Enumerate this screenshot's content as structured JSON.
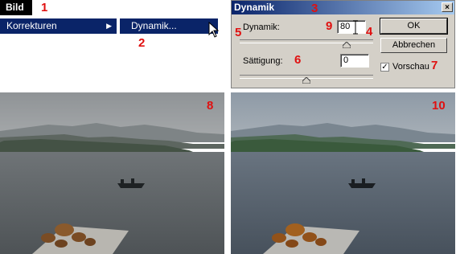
{
  "menu": {
    "bild_label": "Bild",
    "korrekturen_label": "Korrekturen",
    "dynamik_item_label": "Dynamik..."
  },
  "markers": {
    "m1": "1",
    "m2": "2",
    "m3": "3",
    "m4": "4",
    "m5": "5",
    "m6": "6",
    "m7": "7",
    "m8": "8",
    "m9": "9",
    "m10": "10"
  },
  "dialog": {
    "title": "Dynamik",
    "close_glyph": "×",
    "dynamik_label": "Dynamik:",
    "dynamik_value": "80",
    "saettigung_label": "Sättigung:",
    "saettigung_value": "0",
    "dynamik_slider_level": 0.8,
    "saettigung_slider_level": 0.5,
    "ok_label": "OK",
    "cancel_label": "Abbrechen",
    "preview_label": "Vorschau",
    "preview_checked": true,
    "check_glyph": "✓"
  },
  "colors": {
    "menu_highlight": "#0a2468",
    "marker_red": "#e01010",
    "dialog_face": "#d4d0c8"
  },
  "icons": [
    "submenu-arrow-icon",
    "mouse-pointer-icon",
    "close-icon",
    "checkbox-check-icon",
    "slider-thumb-icon",
    "text-cursor-icon"
  ]
}
